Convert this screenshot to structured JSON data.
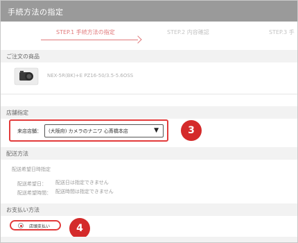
{
  "header": {
    "title": "手続方法の指定"
  },
  "steps": [
    {
      "label": "STEP.1 手続方法の指定",
      "state": "active"
    },
    {
      "label": "STEP.2 内容確認",
      "state": "inactive"
    },
    {
      "label": "STEP.3 手",
      "state": "inactive"
    }
  ],
  "order": {
    "section_title": "ご注文の商品",
    "product_name": "NEX-5R(BK)+E PZ16-50/3.5-5.6OSS"
  },
  "store": {
    "section_title": "店舗指定",
    "label": "来店店舗：",
    "selected": "(大阪府) カメラのナニワ 心斎橋本店",
    "badge": "3"
  },
  "shipping": {
    "section_title": "配送方法",
    "sub_title": "配送希望日時指定",
    "date_label": "配送希望日：",
    "date_value": "配送日は指定できません",
    "time_label": "配送希望時間：",
    "time_value": "配送時間は指定できません"
  },
  "payment": {
    "section_title": "お支払い方法",
    "option": "店頭支払い",
    "badge": "4"
  },
  "colors": {
    "accent": "#e0787a",
    "highlight": "#e23a3a",
    "badge": "#d42a2a",
    "header_bg": "#9a9a9a"
  }
}
